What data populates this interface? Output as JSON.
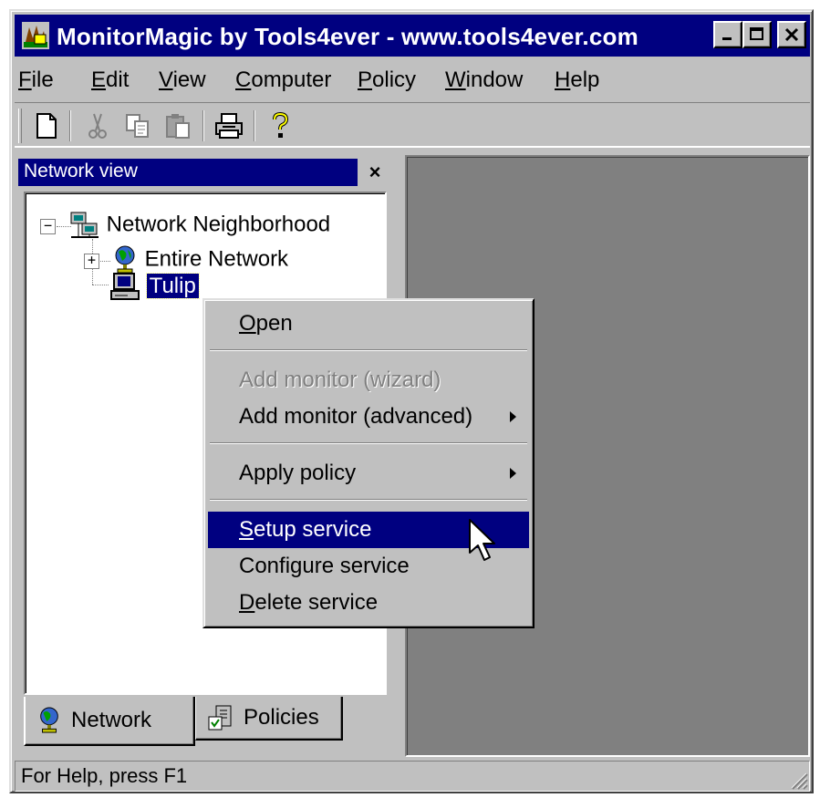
{
  "window": {
    "title": "MonitorMagic by Tools4ever - www.tools4ever.com"
  },
  "menubar": {
    "items": [
      {
        "label": "File",
        "mnemonic": "F",
        "rest": "ile"
      },
      {
        "label": "Edit",
        "mnemonic": "E",
        "rest": "dit"
      },
      {
        "label": "View",
        "mnemonic": "V",
        "rest": "iew"
      },
      {
        "label": "Computer",
        "mnemonic": "C",
        "rest": "omputer"
      },
      {
        "label": "Policy",
        "mnemonic": "P",
        "rest": "olicy"
      },
      {
        "label": "Window",
        "mnemonic": "W",
        "rest": "indow"
      },
      {
        "label": "Help",
        "mnemonic": "H",
        "rest": "elp"
      }
    ]
  },
  "toolbar": {
    "buttons": [
      "new-icon",
      "cut-icon",
      "copy-icon",
      "paste-icon",
      "print-icon",
      "help-icon"
    ]
  },
  "network_view": {
    "title": "Network view",
    "close_glyph": "×",
    "tree": {
      "root": "Network Neighborhood",
      "children": [
        "Entire Network",
        "Tulip"
      ],
      "expand_glyph": "+",
      "collapse_glyph": "−"
    },
    "tabs": [
      "Network",
      "Policies"
    ]
  },
  "context_menu": {
    "items": [
      {
        "mnemonic": "O",
        "rest": "pen"
      },
      {
        "label": "Add monitor (wizard)",
        "disabled": true
      },
      {
        "label": "Add monitor (advanced)"
      },
      {
        "label": "Apply policy"
      },
      {
        "mnemonic": "S",
        "rest": "etup service",
        "highlighted": true
      },
      {
        "label": "Configure service"
      },
      {
        "mnemonic": "D",
        "rest": "elete service"
      }
    ]
  },
  "statusbar": {
    "text": "For Help, press F1"
  },
  "colors": {
    "titlebar": "#000080",
    "face": "#c0c0c0",
    "mdi_background": "#808080",
    "selection": "#000080"
  }
}
